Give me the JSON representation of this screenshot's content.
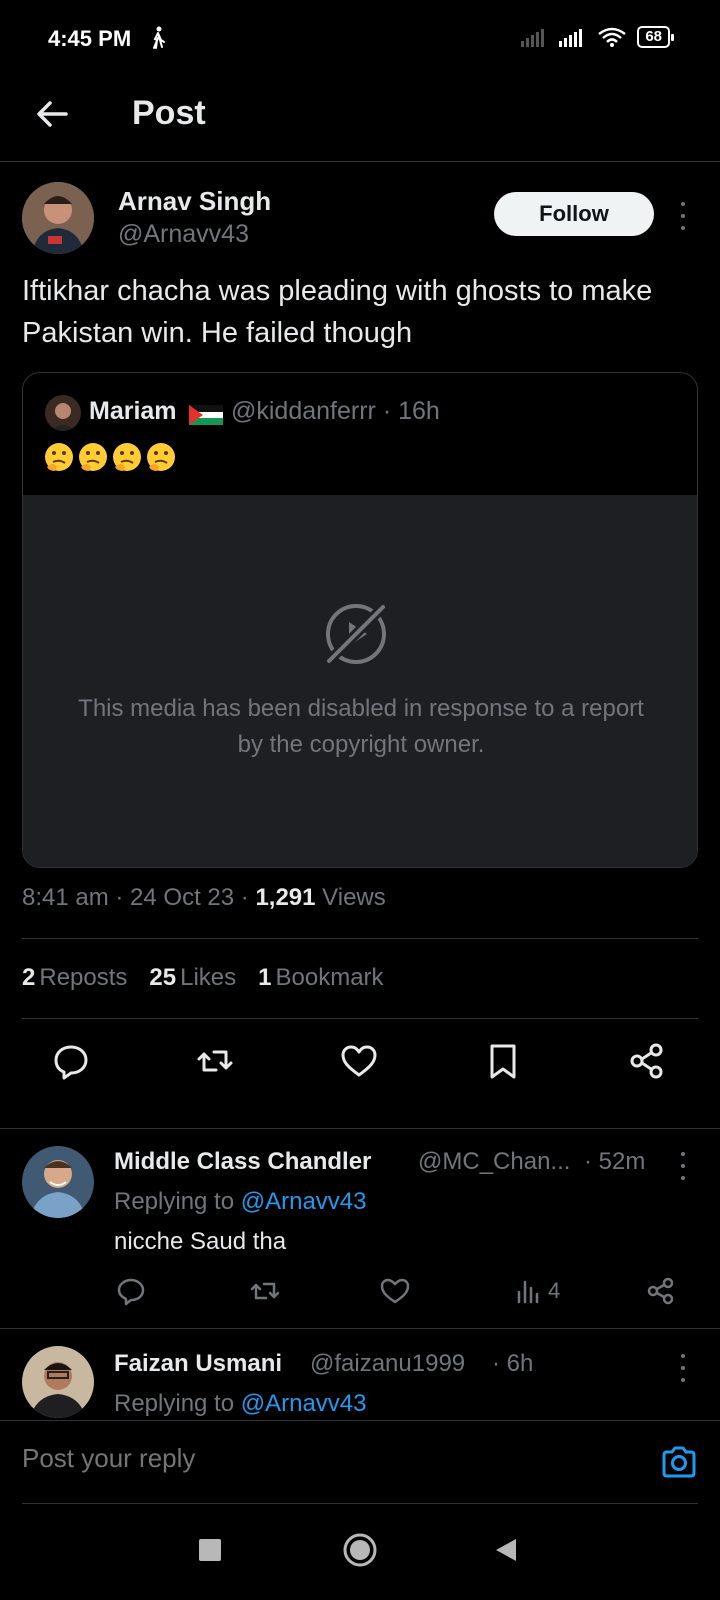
{
  "status_bar": {
    "time": "4:45 PM",
    "battery": "68"
  },
  "header": {
    "title": "Post"
  },
  "post": {
    "author_name": "Arnav Singh",
    "author_handle": "@Arnavv43",
    "follow_label": "Follow",
    "text": "Iftikhar chacha was pleading with ghosts to make Pakistan win. He failed though",
    "quote": {
      "author_name": "Mariam",
      "author_handle_time": "@kiddanferrr · 16h",
      "media_disabled_text": "This media has been disabled in response to a report by the copyright owner."
    },
    "meta": {
      "time_date": "8:41 am · 24 Oct 23 · ",
      "views_count": "1,291",
      "views_label": " Views"
    },
    "stats": {
      "reposts_count": "2",
      "reposts_label": "Reposts",
      "likes_count": "25",
      "likes_label": "Likes",
      "bookmarks_count": "1",
      "bookmarks_label": "Bookmark"
    }
  },
  "replies": [
    {
      "name": "Middle Class Chandler",
      "handle": "@MC_Chan...",
      "time": "· 52m",
      "replying_prefix": "Replying to ",
      "replying_handle": "@Arnavv43",
      "text": "nicche Saud tha",
      "views": "4"
    },
    {
      "name": "Faizan Usmani",
      "handle": "@faizanu1999",
      "time": "· 6h",
      "replying_prefix": "Replying to ",
      "replying_handle": "@Arnavv43"
    }
  ],
  "reply_bar": {
    "placeholder": "Post your reply"
  },
  "colors": {
    "background": "#000000",
    "text": "#e7e9ea",
    "muted": "#71767b",
    "link": "#1d9bf0",
    "border": "#2f3336"
  }
}
